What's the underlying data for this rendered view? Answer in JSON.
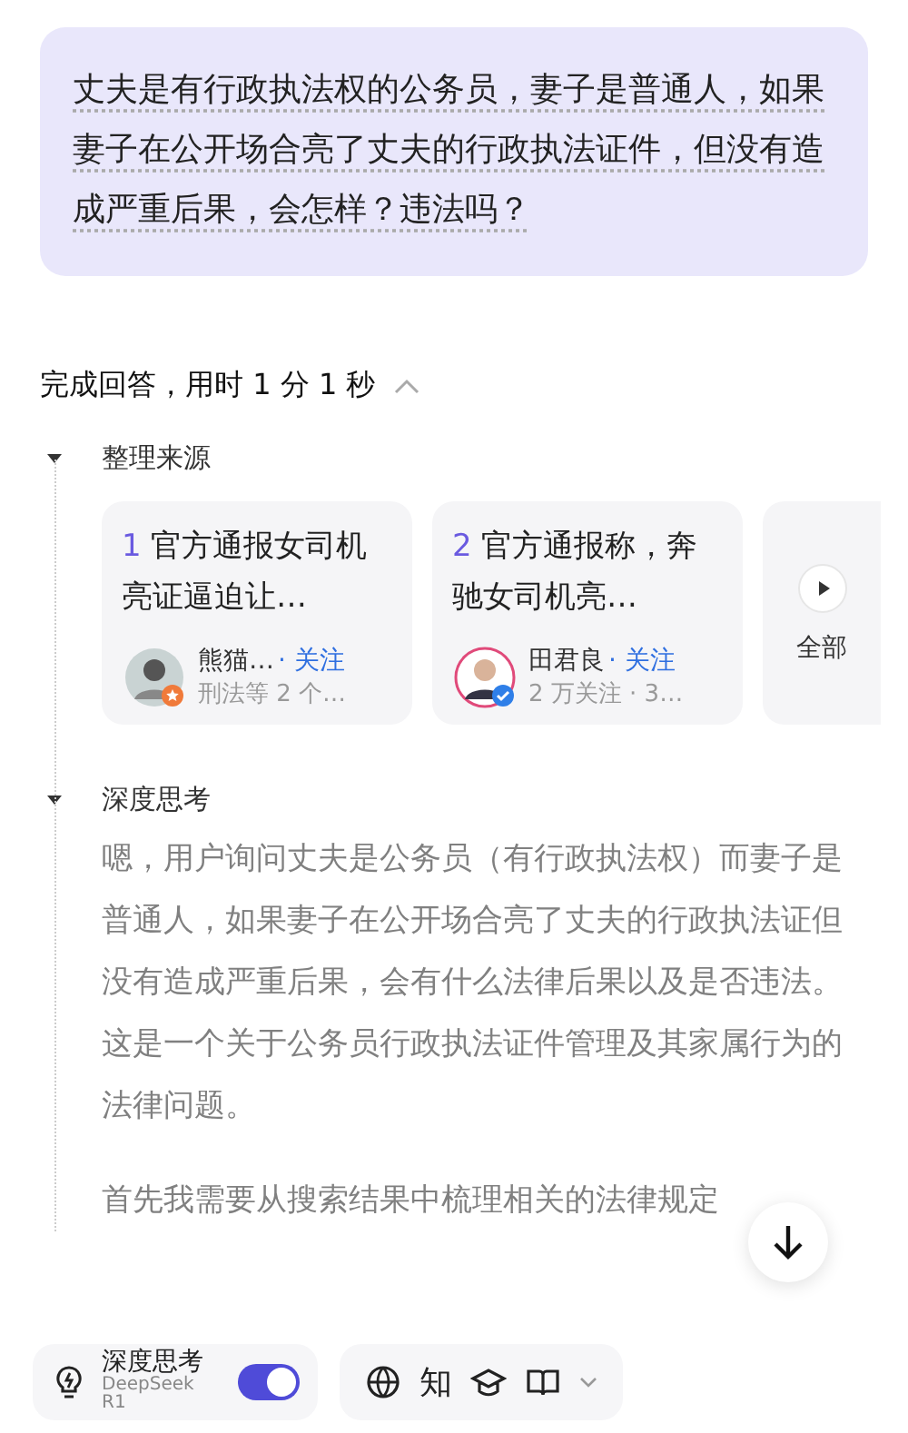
{
  "question": "丈夫是有行政执法权的公务员，妻子是普通人，如果妻子在公开场合亮了丈夫的行政执法证件，但没有造成严重后果，会怎样？违法吗？",
  "status": {
    "text": "完成回答，用时 1 分 1 秒",
    "expanded": true
  },
  "sources": {
    "title": "整理来源",
    "expanded": true,
    "cards": [
      {
        "index": "1",
        "title": "官方通报女司机亮证逼迫让…",
        "author": "熊猫…",
        "follow": "· 关注",
        "meta": "刑法等 2 个…",
        "verified": false
      },
      {
        "index": "2",
        "title": "官方通报称，奔驰女司机亮…",
        "author": "田君良",
        "follow": "· 关注",
        "meta": "2 万关注 · 3…",
        "verified": true
      }
    ],
    "more": "全部"
  },
  "thinking": {
    "title": "深度思考",
    "expanded": true,
    "paragraphs": [
      "嗯，用户询问丈夫是公务员（有行政执法权）而妻子是普通人，如果妻子在公开场合亮了丈夫的行政执法证但没有造成严重后果，会有什么法律后果以及是否违法。这是一个关于公务员行政执法证件管理及其家属行为的法律问题。",
      "首先我需要从搜索结果中梳理相关的法律规定"
    ]
  },
  "toolbar": {
    "deep_think": {
      "label": "深度思考",
      "model": "DeepSeek R1",
      "on": true
    },
    "zhi": "知"
  }
}
